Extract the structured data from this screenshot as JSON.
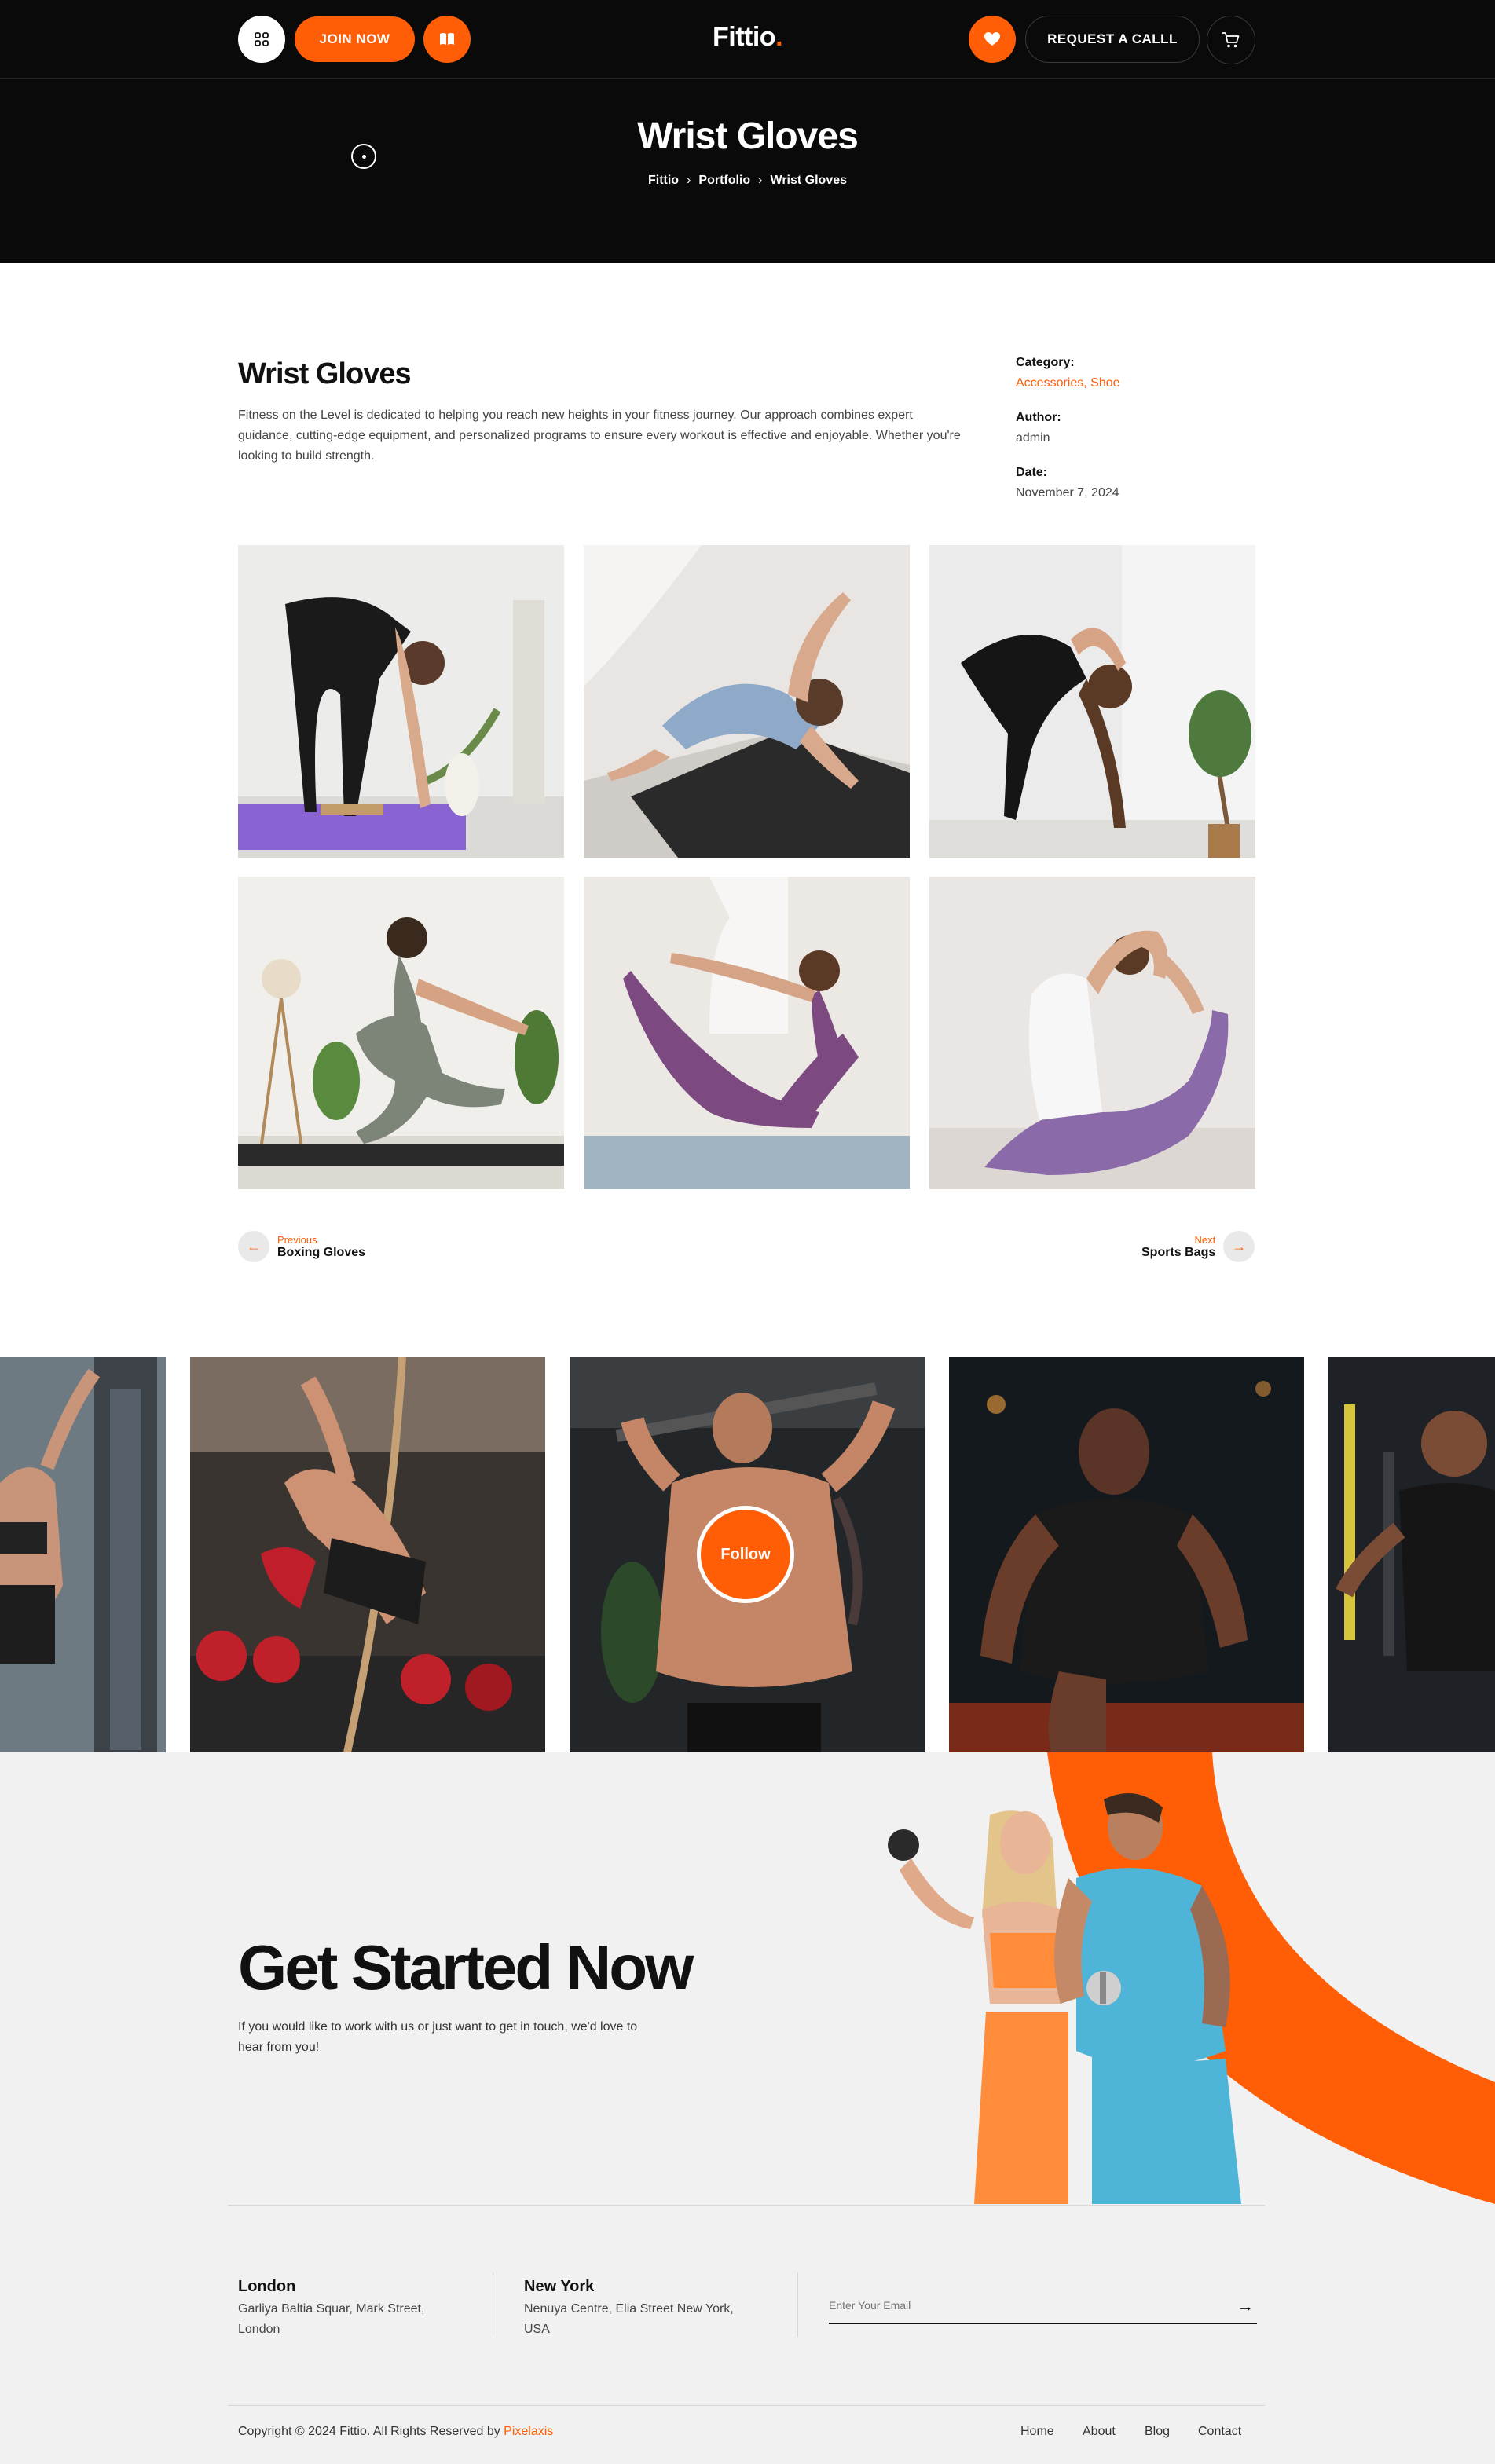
{
  "header": {
    "join_label": "JOIN NOW",
    "logo_text": "Fittio",
    "logo_dot": ".",
    "request_label": "REQUEST A CALLL"
  },
  "hero": {
    "title": "Wrist Gloves",
    "breadcrumb": [
      "Fittio",
      "Portfolio",
      "Wrist Gloves"
    ]
  },
  "project": {
    "title": "Wrist Gloves",
    "description": "Fitness on the Level is dedicated to helping you reach new heights in your fitness journey. Our approach combines expert guidance, cutting-edge equipment, and personalized programs to ensure every workout is effective and enjoyable. Whether you're looking to build strength.",
    "meta": {
      "category_label": "Category:",
      "category_value": "Accessories, Shoe",
      "author_label": "Author:",
      "author_value": "admin",
      "date_label": "Date:",
      "date_value": "November 7, 2024"
    }
  },
  "pager": {
    "prev_small": "Previous",
    "prev_title": "Boxing Gloves",
    "next_small": "Next",
    "next_title": "Sports Bags"
  },
  "instagram": {
    "follow_label": "Follow"
  },
  "cta": {
    "title": "Get Started Now",
    "description": "If you would like to work with us or just want to get in touch, we'd love to hear from you!",
    "offices": [
      {
        "name": "London",
        "address": "Garliya Baltia Squar, Mark Street, London"
      },
      {
        "name": "New York",
        "address": "Nenuya Centre, Elia Street New York, USA"
      }
    ],
    "email_placeholder": "Enter Your Email"
  },
  "footer": {
    "copyright": "Copyright © 2024 Fittio. All Rights Reserved by ",
    "copyright_brand": "Pixelaxis",
    "nav": [
      "Home",
      "About",
      "Blog",
      "Contact"
    ]
  },
  "colors": {
    "accent": "#ff5e07",
    "dark": "#0a0a0a",
    "light_bg": "#f1f1f1"
  },
  "icons": [
    "grid-icon",
    "book-icon",
    "heart-icon",
    "cart-icon",
    "arrow-left-icon",
    "arrow-right-icon"
  ]
}
